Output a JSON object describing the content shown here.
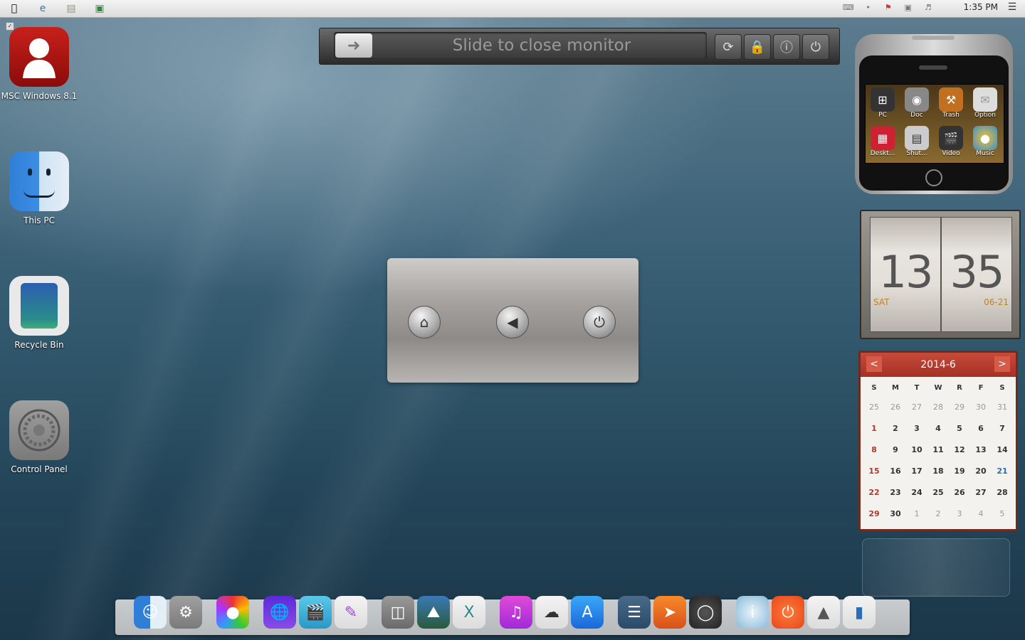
{
  "menubar": {
    "apple_icon": "apple-icon",
    "time": "1:35 PM"
  },
  "desktop_icons": [
    {
      "label": "MSC Windows 8.1",
      "icon": "user-icon"
    },
    {
      "label": "This PC",
      "icon": "finder-icon"
    },
    {
      "label": "Recycle Bin",
      "icon": "trash-icon"
    },
    {
      "label": "Control Panel",
      "icon": "settings-icon"
    }
  ],
  "slidebar": {
    "text": "Slide to close monitor"
  },
  "phone_widget": {
    "apps": [
      {
        "label": "PC"
      },
      {
        "label": "Doc"
      },
      {
        "label": "Trash"
      },
      {
        "label": "Option"
      },
      {
        "label": "Deskt..."
      },
      {
        "label": "Shut..."
      },
      {
        "label": "Video"
      },
      {
        "label": "Music"
      }
    ]
  },
  "clock": {
    "hour": "13",
    "minute": "35",
    "day": "SAT",
    "date": "06-21"
  },
  "calendar": {
    "title": "2014-6",
    "prev": "<",
    "next": ">",
    "dow": [
      "S",
      "M",
      "T",
      "W",
      "R",
      "F",
      "S"
    ],
    "weeks": [
      [
        "25",
        "26",
        "27",
        "28",
        "29",
        "30",
        "31"
      ],
      [
        "1",
        "2",
        "3",
        "4",
        "5",
        "6",
        "7"
      ],
      [
        "8",
        "9",
        "10",
        "11",
        "12",
        "13",
        "14"
      ],
      [
        "15",
        "16",
        "17",
        "18",
        "19",
        "20",
        "21"
      ],
      [
        "22",
        "23",
        "24",
        "25",
        "26",
        "27",
        "28"
      ],
      [
        "29",
        "30",
        "1",
        "2",
        "3",
        "4",
        "5"
      ]
    ],
    "accent": "#b3392b",
    "today": "21"
  },
  "dock": {
    "items": [
      "finder-icon",
      "settings-icon",
      "color-icon",
      "globe-icon",
      "clapper-icon",
      "pen-icon",
      "drive-icon",
      "photo-icon",
      "x-icon",
      "music-icon",
      "cloud-icon",
      "appstore-icon",
      "reader-icon",
      "rocket-icon",
      "gauge-icon",
      "info-icon",
      "power-icon",
      "dev-icon",
      "blue-icon"
    ]
  }
}
